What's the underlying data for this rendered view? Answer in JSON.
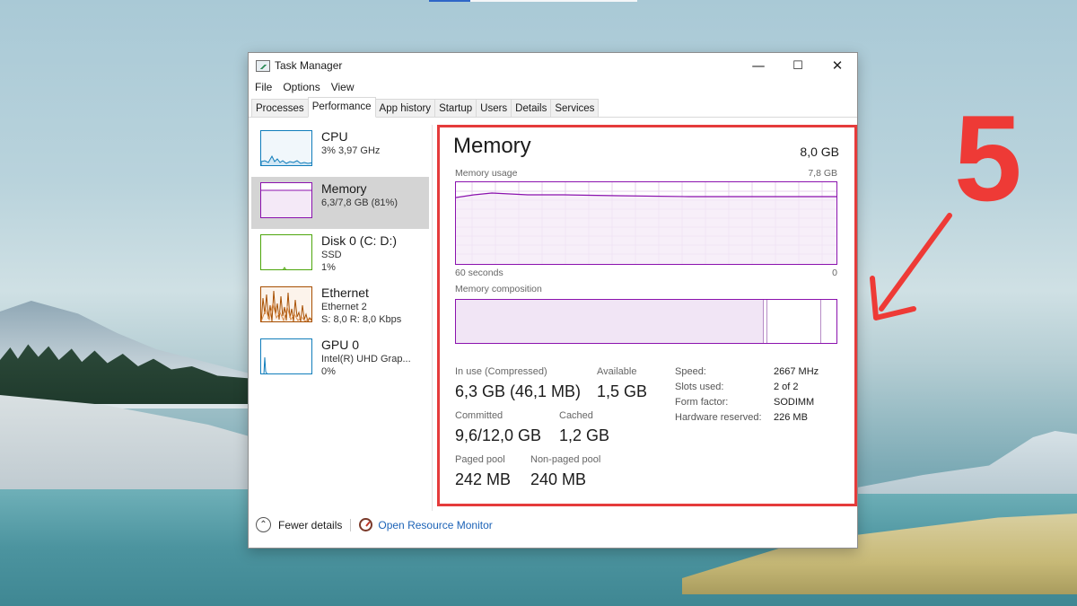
{
  "window": {
    "title": "Task Manager",
    "controls": {
      "minimize": "—",
      "maximize": "☐",
      "close": "✕"
    }
  },
  "menu": [
    "File",
    "Options",
    "View"
  ],
  "tabs": [
    "Processes",
    "Performance",
    "App history",
    "Startup",
    "Users",
    "Details",
    "Services"
  ],
  "active_tab": "Performance",
  "sidebar": {
    "items": [
      {
        "title": "CPU",
        "sub1": "3% 3,97 GHz",
        "sub2": "",
        "color": "#117dbb",
        "icon": "cpu-graph"
      },
      {
        "title": "Memory",
        "sub1": "6,3/7,8 GB (81%)",
        "sub2": "",
        "color": "#8b12ae",
        "icon": "memory-graph",
        "active": true
      },
      {
        "title": "Disk 0 (C: D:)",
        "sub1": "SSD",
        "sub2": "1%",
        "color": "#4da60c",
        "icon": "disk-graph"
      },
      {
        "title": "Ethernet",
        "sub1": "Ethernet 2",
        "sub2": "S: 8,0  R: 8,0 Kbps",
        "color": "#a74f01",
        "icon": "ethernet-graph"
      },
      {
        "title": "GPU 0",
        "sub1": "Intel(R) UHD Grap...",
        "sub2": "0%",
        "color": "#117dbb",
        "icon": "gpu-graph"
      }
    ]
  },
  "memory": {
    "title": "Memory",
    "total": "8,0 GB",
    "usage_label": "Memory usage",
    "usage_max": "7,8 GB",
    "time_left": "60 seconds",
    "time_right": "0",
    "composition_label": "Memory composition",
    "usage_fraction": 0.81,
    "stats": {
      "in_use_label": "In use (Compressed)",
      "in_use_value": "6,3 GB (46,1 MB)",
      "available_label": "Available",
      "available_value": "1,5 GB",
      "committed_label": "Committed",
      "committed_value": "9,6/12,0 GB",
      "cached_label": "Cached",
      "cached_value": "1,2 GB",
      "paged_label": "Paged pool",
      "paged_value": "242 MB",
      "nonpaged_label": "Non-paged pool",
      "nonpaged_value": "240 MB"
    },
    "hardware": {
      "speed_label": "Speed:",
      "speed_value": "2667 MHz",
      "slots_label": "Slots used:",
      "slots_value": "2 of 2",
      "form_label": "Form factor:",
      "form_value": "SODIMM",
      "reserved_label": "Hardware reserved:",
      "reserved_value": "226 MB"
    }
  },
  "footer": {
    "fewer_details": "Fewer details",
    "resource_monitor": "Open Resource Monitor"
  },
  "annotation": {
    "number": "5",
    "color": "#e53b3b"
  }
}
